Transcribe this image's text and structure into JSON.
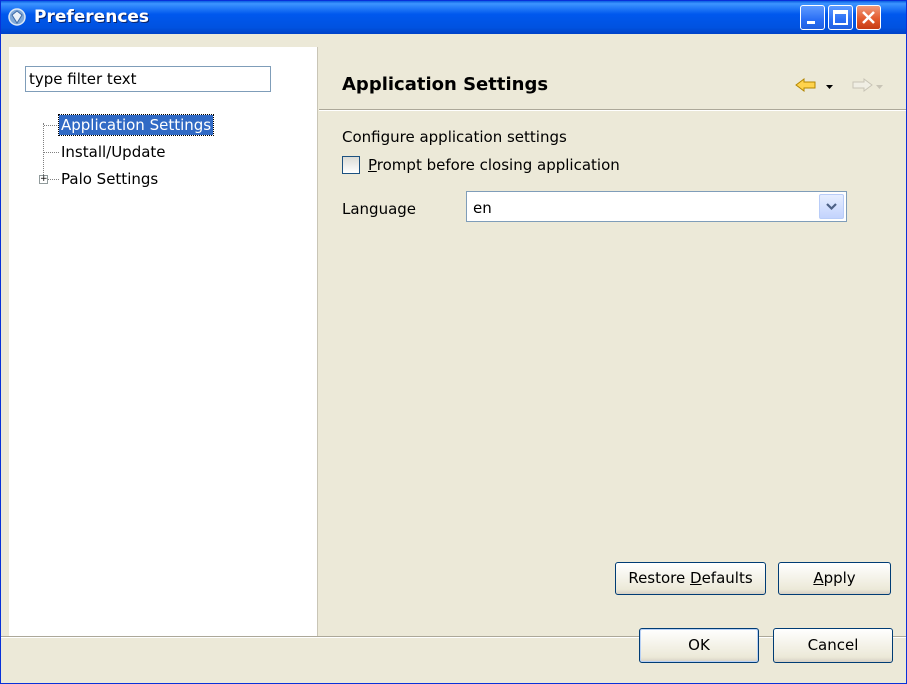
{
  "window": {
    "title": "Preferences",
    "controls": {
      "minimize_icon": "minimize-icon",
      "maximize_icon": "maximize-icon",
      "close_icon": "close-icon"
    }
  },
  "left": {
    "filter_placeholder": "type filter text",
    "tree": [
      {
        "label": "Application Settings",
        "selected": true,
        "expandable": false
      },
      {
        "label": "Install/Update",
        "selected": false,
        "expandable": false
      },
      {
        "label": "Palo Settings",
        "selected": false,
        "expandable": true
      }
    ]
  },
  "page": {
    "title": "Application Settings",
    "nav": {
      "back_icon": "back-arrow-icon",
      "forward_icon": "forward-arrow-icon",
      "dropdown_icon": "chevron-down-icon"
    },
    "description": "Configure application settings",
    "prompt_checkbox": {
      "label_mnemonic": "P",
      "label_rest": "rompt before closing application",
      "checked": false
    },
    "language": {
      "label": "Language",
      "value": "en"
    },
    "restore_defaults_pre": "Restore ",
    "restore_defaults_mnemonic": "D",
    "restore_defaults_post": "efaults",
    "apply_mnemonic": "A",
    "apply_rest": "pply"
  },
  "footer": {
    "ok": "OK",
    "cancel": "Cancel"
  },
  "colors": {
    "titlebar": "#0058ee",
    "selection": "#316ac5",
    "dialog_bg": "#ece9d8"
  }
}
